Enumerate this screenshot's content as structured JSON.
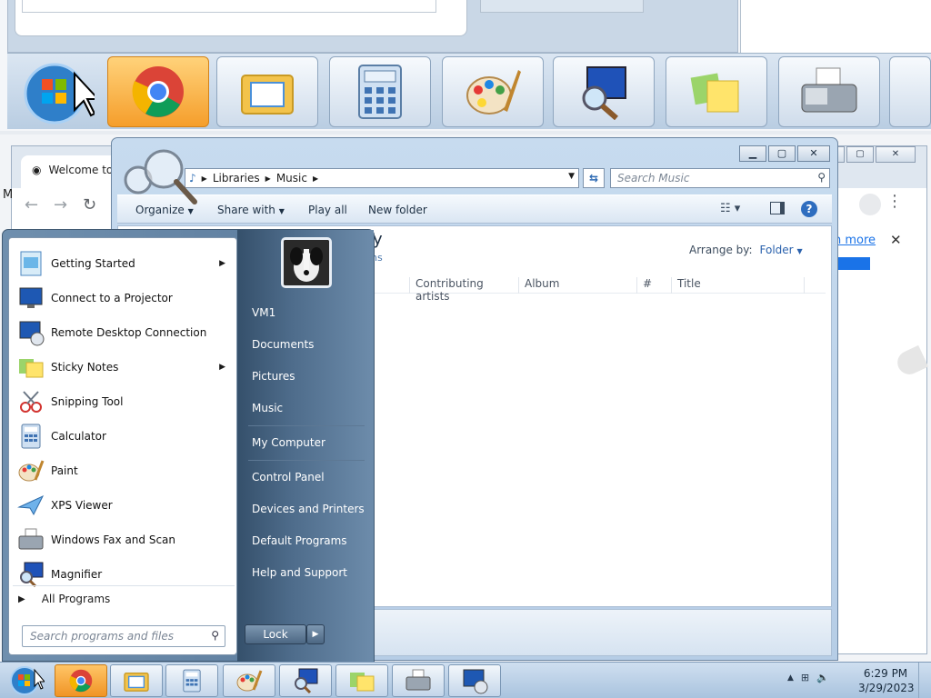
{
  "chrome": {
    "tab_title": "Welcome to",
    "infobar_link": "n more",
    "infobar_close": "✕",
    "left_letter": "M"
  },
  "explorer": {
    "address": [
      "Libraries",
      "Music"
    ],
    "search_placeholder": "Search Music",
    "commands": {
      "organize": "Organize",
      "share_with": "Share with",
      "play_all": "Play all",
      "new_folder": "New folder"
    },
    "library_title": "y",
    "library_sub": "ns",
    "arrange_by_label": "Arrange by:",
    "arrange_by_value": "Folder",
    "columns": [
      "Contributing artists",
      "Album",
      "#",
      "Title"
    ],
    "help": "?"
  },
  "start_menu": {
    "programs": [
      {
        "label": "Getting Started",
        "icon": "getting-started-icon",
        "has_submenu": true
      },
      {
        "label": "Connect to a Projector",
        "icon": "projector-icon",
        "has_submenu": false
      },
      {
        "label": "Remote Desktop Connection",
        "icon": "remote-desktop-icon",
        "has_submenu": false
      },
      {
        "label": "Sticky Notes",
        "icon": "sticky-notes-icon",
        "has_submenu": true
      },
      {
        "label": "Snipping Tool",
        "icon": "snipping-tool-icon",
        "has_submenu": false
      },
      {
        "label": "Calculator",
        "icon": "calculator-icon",
        "has_submenu": false
      },
      {
        "label": "Paint",
        "icon": "paint-icon",
        "has_submenu": false
      },
      {
        "label": "XPS Viewer",
        "icon": "xps-viewer-icon",
        "has_submenu": false
      },
      {
        "label": "Windows Fax and Scan",
        "icon": "fax-scan-icon",
        "has_submenu": false
      },
      {
        "label": "Magnifier",
        "icon": "magnifier-icon",
        "has_submenu": false
      }
    ],
    "all_programs": "All Programs",
    "search_placeholder": "Search programs and files",
    "right_links": [
      "VM1",
      "Documents",
      "Pictures",
      "Music",
      "My Computer",
      "Control Panel",
      "Devices and Printers",
      "Default Programs",
      "Help and Support"
    ],
    "lock_label": "Lock"
  },
  "taskbar": {
    "time": "6:29 PM",
    "date": "3/29/2023",
    "buttons": [
      "chrome",
      "file-explorer",
      "calculator",
      "paint",
      "magnifier",
      "sticky-notes",
      "fax-scan",
      "remote-desktop"
    ]
  },
  "colors": {
    "accent_blue": "#1a73e8",
    "start_right_panel": "#4e6c8b",
    "taskbar": "#bcd2e8"
  }
}
